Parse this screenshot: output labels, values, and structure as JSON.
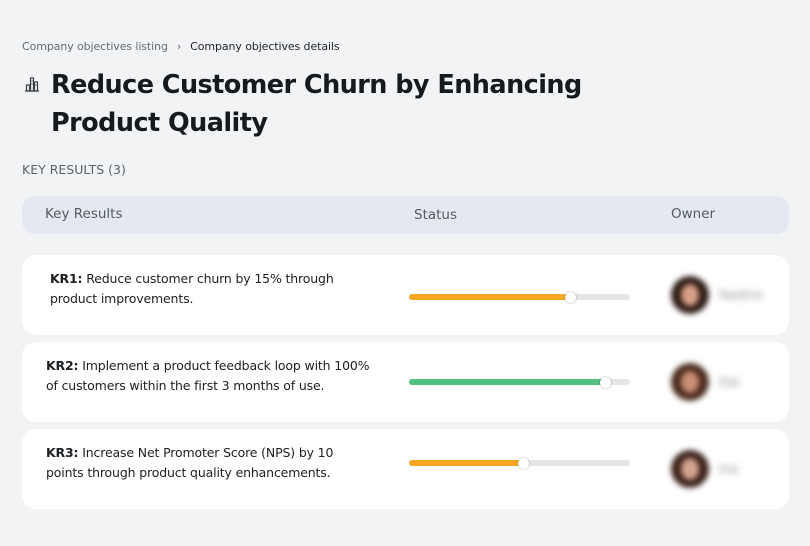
{
  "breadcrumb": {
    "parent": "Company objectives listing",
    "separator": "›",
    "current": "Company objectives details"
  },
  "objective": {
    "icon": "building-chart-icon",
    "title": "Reduce Customer Churn by Enhancing Product Quality"
  },
  "key_results_label": "KEY RESULTS (3)",
  "table": {
    "headers": [
      "Key Results",
      "Status",
      "Owner"
    ]
  },
  "key_results": [
    {
      "code": "KR1:",
      "line1": " Reduce customer churn by 15% through",
      "line2": "product improvements.",
      "progress": 0.73,
      "color": "#f5a623",
      "owner": "Nadine"
    },
    {
      "code": "KR2:",
      "line1": " Implement a product feedback loop with 100%",
      "line2": "of customers within the first 3 months of use.",
      "progress": 0.89,
      "color": "#54c07f",
      "owner": "Dai"
    },
    {
      "code": "KR3:",
      "line1": " Increase Net Promoter Score (NPS) by 10",
      "line2": "points through product quality enhancements.",
      "progress": 0.52,
      "color": "#f5a623",
      "owner": "Ina"
    }
  ]
}
